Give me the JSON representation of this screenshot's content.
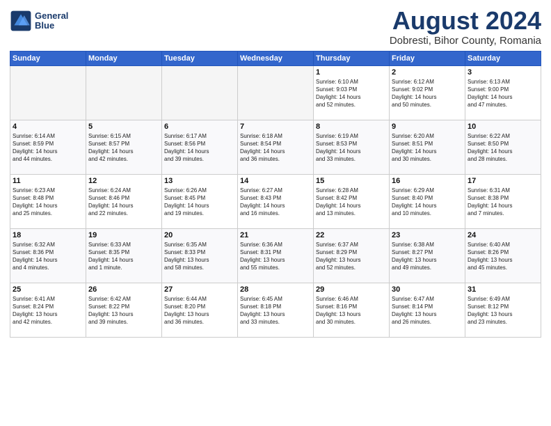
{
  "header": {
    "logo_line1": "General",
    "logo_line2": "Blue",
    "month_year": "August 2024",
    "location": "Dobresti, Bihor County, Romania"
  },
  "days_of_week": [
    "Sunday",
    "Monday",
    "Tuesday",
    "Wednesday",
    "Thursday",
    "Friday",
    "Saturday"
  ],
  "weeks": [
    [
      {
        "day": "",
        "info": ""
      },
      {
        "day": "",
        "info": ""
      },
      {
        "day": "",
        "info": ""
      },
      {
        "day": "",
        "info": ""
      },
      {
        "day": "1",
        "info": "Sunrise: 6:10 AM\nSunset: 9:03 PM\nDaylight: 14 hours\nand 52 minutes."
      },
      {
        "day": "2",
        "info": "Sunrise: 6:12 AM\nSunset: 9:02 PM\nDaylight: 14 hours\nand 50 minutes."
      },
      {
        "day": "3",
        "info": "Sunrise: 6:13 AM\nSunset: 9:00 PM\nDaylight: 14 hours\nand 47 minutes."
      }
    ],
    [
      {
        "day": "4",
        "info": "Sunrise: 6:14 AM\nSunset: 8:59 PM\nDaylight: 14 hours\nand 44 minutes."
      },
      {
        "day": "5",
        "info": "Sunrise: 6:15 AM\nSunset: 8:57 PM\nDaylight: 14 hours\nand 42 minutes."
      },
      {
        "day": "6",
        "info": "Sunrise: 6:17 AM\nSunset: 8:56 PM\nDaylight: 14 hours\nand 39 minutes."
      },
      {
        "day": "7",
        "info": "Sunrise: 6:18 AM\nSunset: 8:54 PM\nDaylight: 14 hours\nand 36 minutes."
      },
      {
        "day": "8",
        "info": "Sunrise: 6:19 AM\nSunset: 8:53 PM\nDaylight: 14 hours\nand 33 minutes."
      },
      {
        "day": "9",
        "info": "Sunrise: 6:20 AM\nSunset: 8:51 PM\nDaylight: 14 hours\nand 30 minutes."
      },
      {
        "day": "10",
        "info": "Sunrise: 6:22 AM\nSunset: 8:50 PM\nDaylight: 14 hours\nand 28 minutes."
      }
    ],
    [
      {
        "day": "11",
        "info": "Sunrise: 6:23 AM\nSunset: 8:48 PM\nDaylight: 14 hours\nand 25 minutes."
      },
      {
        "day": "12",
        "info": "Sunrise: 6:24 AM\nSunset: 8:46 PM\nDaylight: 14 hours\nand 22 minutes."
      },
      {
        "day": "13",
        "info": "Sunrise: 6:26 AM\nSunset: 8:45 PM\nDaylight: 14 hours\nand 19 minutes."
      },
      {
        "day": "14",
        "info": "Sunrise: 6:27 AM\nSunset: 8:43 PM\nDaylight: 14 hours\nand 16 minutes."
      },
      {
        "day": "15",
        "info": "Sunrise: 6:28 AM\nSunset: 8:42 PM\nDaylight: 14 hours\nand 13 minutes."
      },
      {
        "day": "16",
        "info": "Sunrise: 6:29 AM\nSunset: 8:40 PM\nDaylight: 14 hours\nand 10 minutes."
      },
      {
        "day": "17",
        "info": "Sunrise: 6:31 AM\nSunset: 8:38 PM\nDaylight: 14 hours\nand 7 minutes."
      }
    ],
    [
      {
        "day": "18",
        "info": "Sunrise: 6:32 AM\nSunset: 8:36 PM\nDaylight: 14 hours\nand 4 minutes."
      },
      {
        "day": "19",
        "info": "Sunrise: 6:33 AM\nSunset: 8:35 PM\nDaylight: 14 hours\nand 1 minute."
      },
      {
        "day": "20",
        "info": "Sunrise: 6:35 AM\nSunset: 8:33 PM\nDaylight: 13 hours\nand 58 minutes."
      },
      {
        "day": "21",
        "info": "Sunrise: 6:36 AM\nSunset: 8:31 PM\nDaylight: 13 hours\nand 55 minutes."
      },
      {
        "day": "22",
        "info": "Sunrise: 6:37 AM\nSunset: 8:29 PM\nDaylight: 13 hours\nand 52 minutes."
      },
      {
        "day": "23",
        "info": "Sunrise: 6:38 AM\nSunset: 8:27 PM\nDaylight: 13 hours\nand 49 minutes."
      },
      {
        "day": "24",
        "info": "Sunrise: 6:40 AM\nSunset: 8:26 PM\nDaylight: 13 hours\nand 45 minutes."
      }
    ],
    [
      {
        "day": "25",
        "info": "Sunrise: 6:41 AM\nSunset: 8:24 PM\nDaylight: 13 hours\nand 42 minutes."
      },
      {
        "day": "26",
        "info": "Sunrise: 6:42 AM\nSunset: 8:22 PM\nDaylight: 13 hours\nand 39 minutes."
      },
      {
        "day": "27",
        "info": "Sunrise: 6:44 AM\nSunset: 8:20 PM\nDaylight: 13 hours\nand 36 minutes."
      },
      {
        "day": "28",
        "info": "Sunrise: 6:45 AM\nSunset: 8:18 PM\nDaylight: 13 hours\nand 33 minutes."
      },
      {
        "day": "29",
        "info": "Sunrise: 6:46 AM\nSunset: 8:16 PM\nDaylight: 13 hours\nand 30 minutes."
      },
      {
        "day": "30",
        "info": "Sunrise: 6:47 AM\nSunset: 8:14 PM\nDaylight: 13 hours\nand 26 minutes."
      },
      {
        "day": "31",
        "info": "Sunrise: 6:49 AM\nSunset: 8:12 PM\nDaylight: 13 hours\nand 23 minutes."
      }
    ]
  ]
}
